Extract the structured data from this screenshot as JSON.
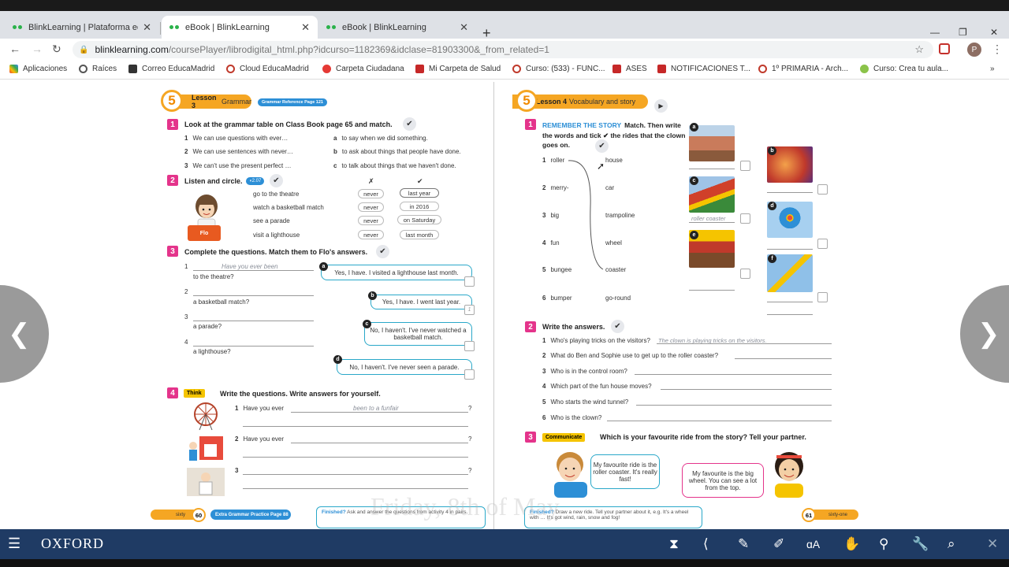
{
  "browser": {
    "tabs": [
      {
        "title": "BlinkLearning | Plataforma educ",
        "active": false
      },
      {
        "title": "eBook | BlinkLearning",
        "active": true
      },
      {
        "title": "eBook | BlinkLearning",
        "active": false
      }
    ],
    "url_host": "blinklearning.com",
    "url_path": "/coursePlayer/librodigital_html.php?idcurso=1182369&idclase=81903300&_from_related=1",
    "profile_initial": "P",
    "bookmarks": [
      "Aplicaciones",
      "Raíces",
      "Correo EducaMadrid",
      "Cloud EducaMadrid",
      "Carpeta Ciudadana",
      "Mi Carpeta de Salud",
      "Curso: (533) - FUNC...",
      "ASES",
      "NOTIFICACIONES T...",
      "1º PRIMARIA - Arch...",
      "Curso: Crea tu aula..."
    ]
  },
  "left_page": {
    "lesson_number": "5",
    "lesson_label": "Lesson 3",
    "lesson_topic": "Grammar",
    "ref_badge": "Grammar Reference Page 121",
    "ex1": {
      "num": "1",
      "title": "Look at the grammar table on Class Book page 65 and match.",
      "items": [
        {
          "n": "1",
          "text": "We can use questions with ever…"
        },
        {
          "n": "2",
          "text": "We can use sentences with never…"
        },
        {
          "n": "3",
          "text": "We can't use the present perfect …"
        }
      ],
      "options": [
        {
          "n": "a",
          "text": "to say when we did something."
        },
        {
          "n": "b",
          "text": "to ask about things that people have done."
        },
        {
          "n": "c",
          "text": "to talk about things that we haven't done."
        }
      ]
    },
    "ex2": {
      "num": "2",
      "title": "Listen and circle.",
      "audio": "2.07",
      "name": "Flo",
      "col_x": "✗",
      "col_check": "✔",
      "rows": [
        {
          "text": "go to the theatre",
          "x": "never",
          "check": "last year"
        },
        {
          "text": "watch a basketball match",
          "x": "never",
          "check": "in 2016"
        },
        {
          "text": "see a parade",
          "x": "never",
          "check": "on Saturday"
        },
        {
          "text": "visit a lighthouse",
          "x": "never",
          "check": "last month"
        }
      ]
    },
    "ex3": {
      "num": "3",
      "title": "Complete the questions. Match them to Flo's answers.",
      "q": [
        {
          "n": "1",
          "answer": "Have you ever been",
          "rest": "to the theatre?"
        },
        {
          "n": "2",
          "answer": "",
          "rest": "a basketball match?"
        },
        {
          "n": "3",
          "answer": "",
          "rest": "a parade?"
        },
        {
          "n": "4",
          "answer": "",
          "rest": "a lighthouse?"
        }
      ],
      "bubbles": [
        {
          "l": "a",
          "text": "Yes, I have. I visited a lighthouse last month."
        },
        {
          "l": "b",
          "text": "Yes, I have. I went last year."
        },
        {
          "l": "c",
          "text": "No, I haven't. I've never watched a basketball match."
        },
        {
          "l": "d",
          "text": "No, I haven't. I've never seen a parade."
        }
      ],
      "box_b": "1"
    },
    "ex4": {
      "num": "4",
      "think": "Think",
      "title": "Write the questions. Write answers for yourself.",
      "rows": [
        {
          "n": "1",
          "text": "Have you ever",
          "answer": "been to a funfair",
          "end": "?"
        },
        {
          "n": "2",
          "text": "Have you ever",
          "answer": "",
          "end": "?"
        },
        {
          "n": "3",
          "text": "",
          "answer": "",
          "end": "?"
        }
      ]
    },
    "footer": {
      "page_word": "sixty",
      "page_num": "60",
      "extra": "Extra Grammar Practice Page 88",
      "finished_label": "Finished?",
      "finished_text": "Ask and answer the questions from activity 4 in pairs."
    }
  },
  "right_page": {
    "lesson_number": "5",
    "lesson_label": "Lesson 4",
    "lesson_topic": "Vocabulary and story",
    "ex1": {
      "num": "1",
      "heading": "REMEMBER THE STORY",
      "title": "Match. Then write the words and tick ✔ the rides that the clown goes on.",
      "left": [
        "roller",
        "merry-",
        "big",
        "fun",
        "bungee",
        "bumper"
      ],
      "right": [
        "house",
        "car",
        "trampoline",
        "wheel",
        "coaster",
        "go-round"
      ],
      "photo_letters": [
        "a",
        "b",
        "c",
        "d",
        "e",
        "f"
      ],
      "photo_c_answer": "roller coaster"
    },
    "ex2": {
      "num": "2",
      "title": "Write the answers.",
      "questions": [
        {
          "n": "1",
          "text": "Who's playing tricks on the visitors?",
          "answer": "The clown is playing tricks on the visitors."
        },
        {
          "n": "2",
          "text": "What do Ben and Sophie use to get up to the roller coaster?",
          "answer": ""
        },
        {
          "n": "3",
          "text": "Who is in the control room?",
          "answer": ""
        },
        {
          "n": "4",
          "text": "Which part of the fun house moves?",
          "answer": ""
        },
        {
          "n": "5",
          "text": "Who starts the wind tunnel?",
          "answer": ""
        },
        {
          "n": "6",
          "text": "Who is the clown?",
          "answer": ""
        }
      ]
    },
    "ex3": {
      "num": "3",
      "tag": "Communicate",
      "title": "Which is your favourite ride from the story? Tell your partner.",
      "bubble1": "My favourite ride is the roller coaster. It's really fast!",
      "bubble2": "My favourite is the big wheel. You can see a lot from the top."
    },
    "footer": {
      "finished_label": "Finished?",
      "finished_text": "Draw a new ride. Tell your partner about it, e.g. It's a wheel with … It's got wind, rain, snow and fog!",
      "page_num": "61",
      "page_word": "sixty-one"
    }
  },
  "watermark": "Friday, 8th of May",
  "bottom": {
    "logo": "OXFORD"
  },
  "colors": {
    "accent": "#e4348b",
    "orange": "#f5a623",
    "blue": "#2d8fd6",
    "toolbar": "#1f3b64"
  }
}
